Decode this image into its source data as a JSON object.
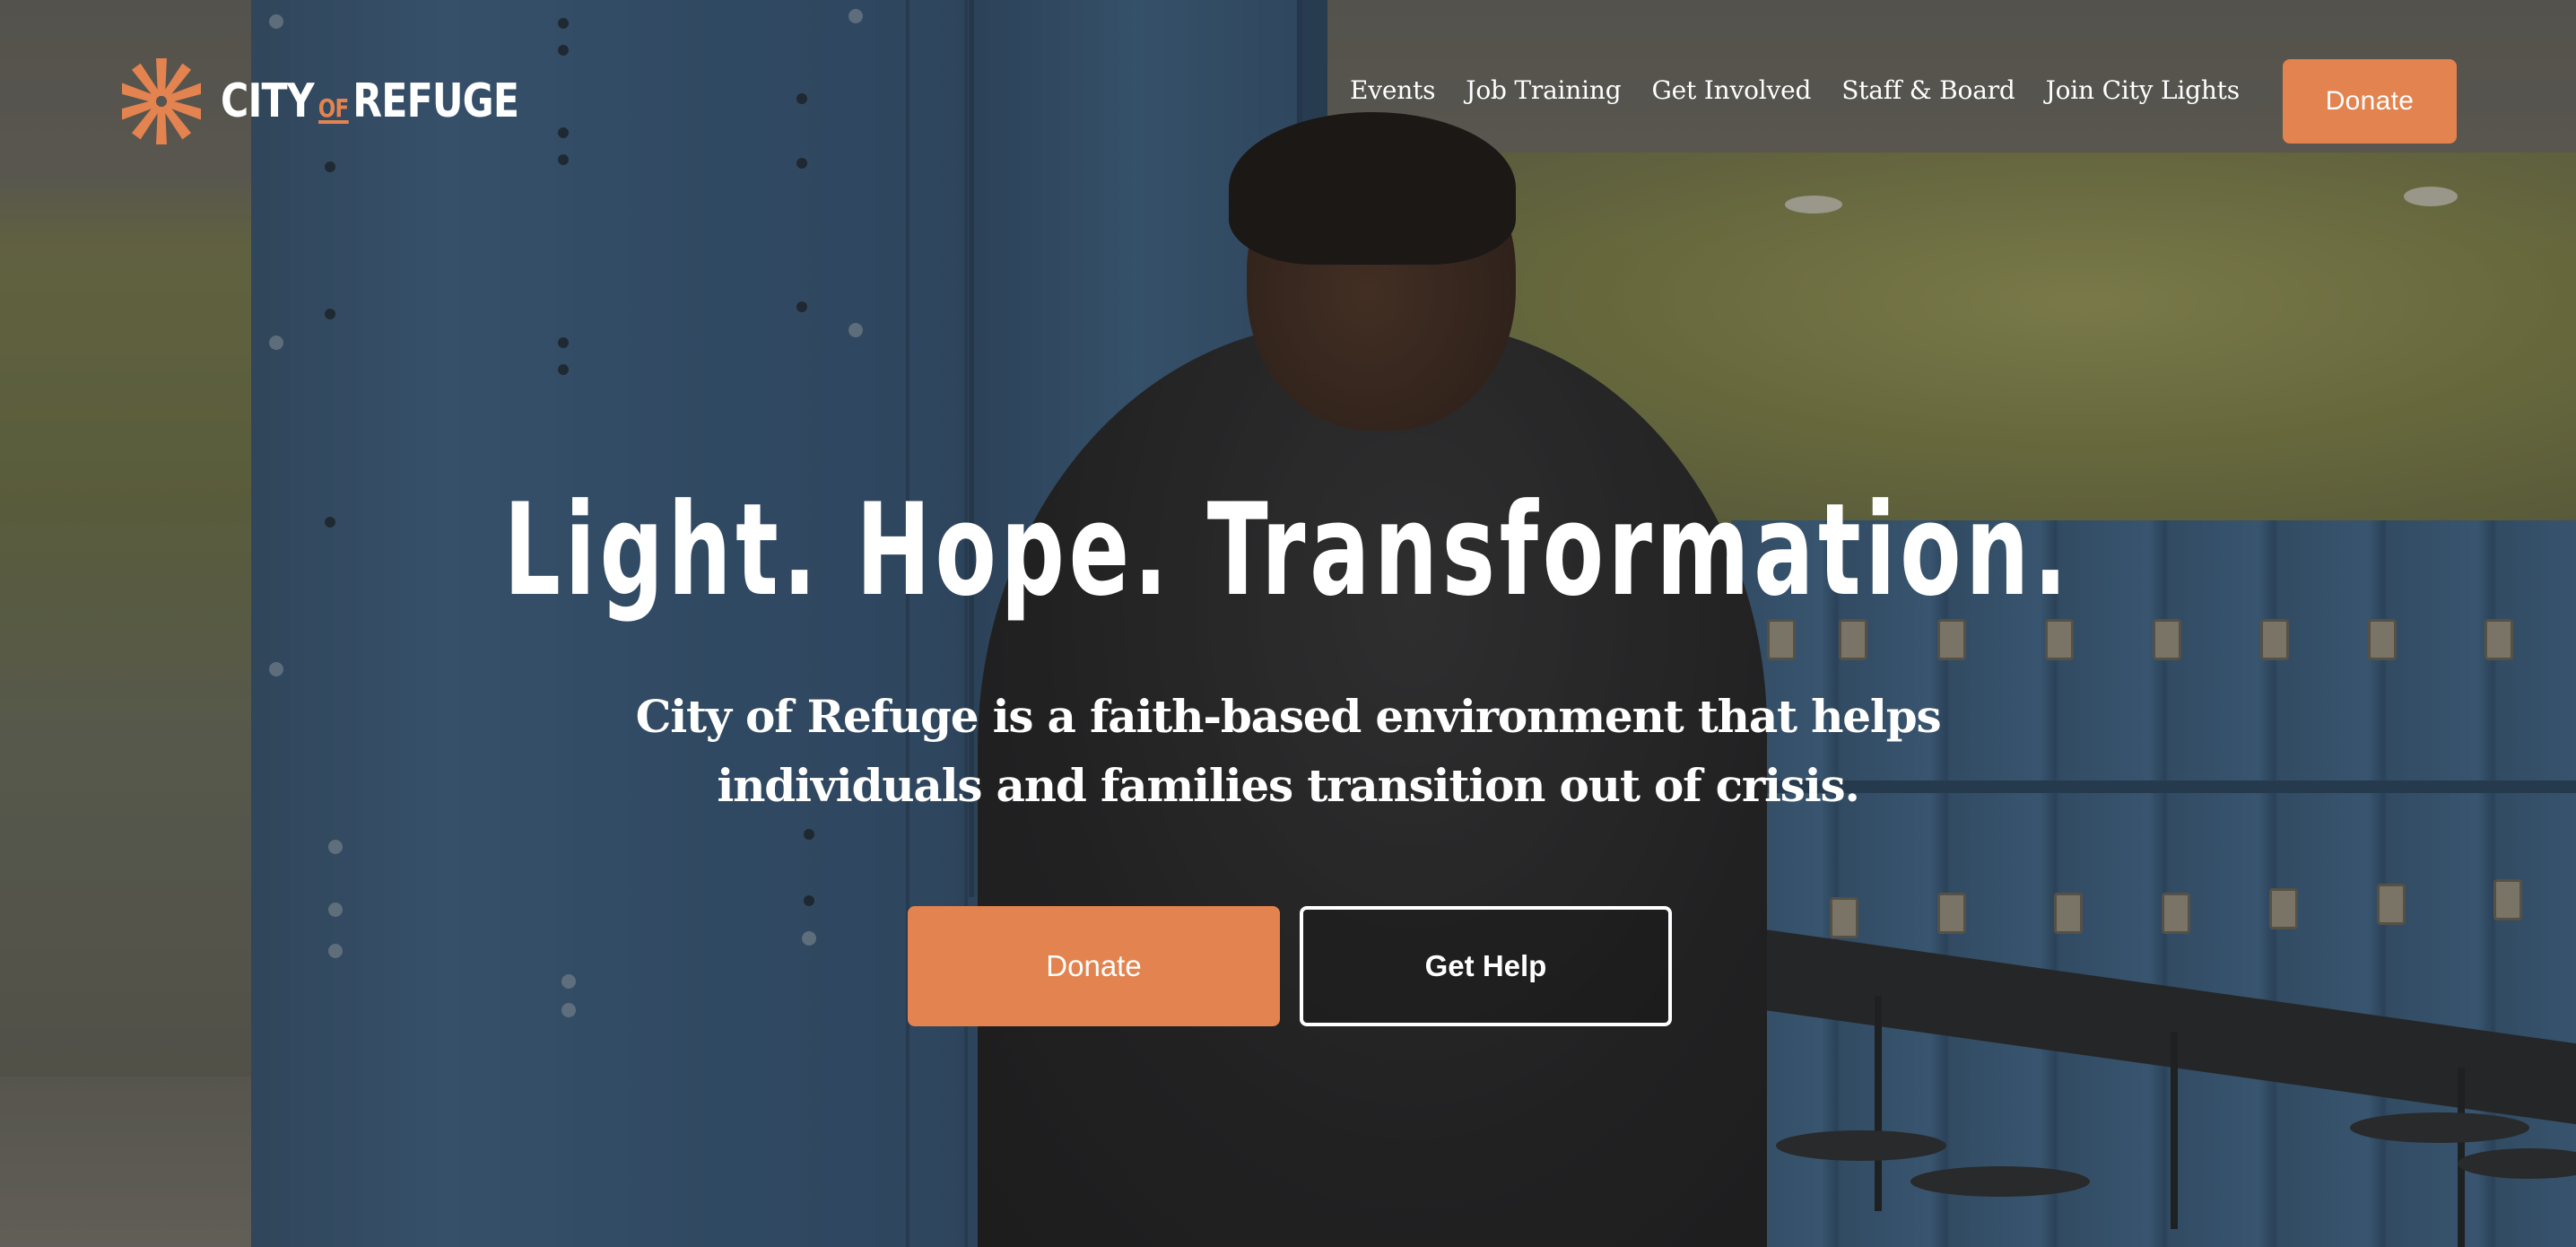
{
  "brand": {
    "logo_text_city": "CITY",
    "logo_text_of": "OF",
    "logo_text_refuge": "REFUGE",
    "logo_icon": "sunburst-icon",
    "accent_color": "#e3834f"
  },
  "nav": {
    "items": [
      {
        "label": "Events"
      },
      {
        "label": "Job Training"
      },
      {
        "label": "Get Involved"
      },
      {
        "label": "Staff & Board"
      },
      {
        "label": "Join City Lights"
      }
    ],
    "donate_label": "Donate"
  },
  "hero": {
    "title": "Light. Hope. Transformation.",
    "subtitle": "City of Refuge is a faith-based environment that helps individuals and families transition out of crisis.",
    "primary_button": "Donate",
    "secondary_button": "Get Help"
  }
}
